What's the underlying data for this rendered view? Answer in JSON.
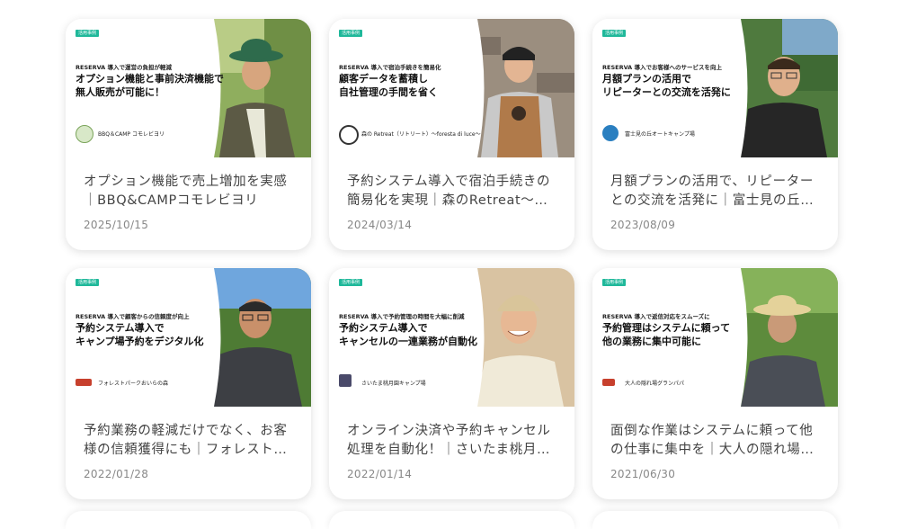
{
  "tag_label": "活用事例",
  "cards": [
    {
      "thumb_subtitle": "RESERVA 導入で運営の負担が軽減",
      "thumb_headline": "オプション機能と事前決済機能で\n無人販売が可能に！",
      "thumb_logo_text": "BBQ＆CAMP コモレビヨリ",
      "title": "オプション機能で売上増加を実感｜BBQ&CAMPコモレビヨリ",
      "date": "2025/10/15"
    },
    {
      "thumb_subtitle": "RESERVA 導入で宿泊手続きを簡易化",
      "thumb_headline": "顧客データを蓄積し\n自社管理の手間を省く",
      "thumb_logo_text": "森の Retreat（リトリート）〜foresta di luce〜",
      "title": "予約システム導入で宿泊手続きの簡易化を実現｜森のRetreat〜…",
      "date": "2024/03/14"
    },
    {
      "thumb_subtitle": "RESERVA 導入でお客様へのサービスを向上",
      "thumb_headline": "月額プランの活用で\nリピーターとの交流を活発に",
      "thumb_logo_text": "富士見の丘オートキャンプ場",
      "title": "月額プランの活用で、リピーターとの交流を活発に｜富士見の丘…",
      "date": "2023/08/09"
    },
    {
      "thumb_subtitle": "RESERVA 導入で顧客からの信頼度が向上",
      "thumb_headline": "予約システム導入で\nキャンプ場予約をデジタル化",
      "thumb_logo_text": "フォレストパークおいらの森",
      "title": "予約業務の軽減だけでなく、お客様の信頼獲得にも｜フォレスト…",
      "date": "2022/01/28"
    },
    {
      "thumb_subtitle": "RESERVA 導入で予約管理の時間を大幅に削減",
      "thumb_headline": "予約システム導入で\nキャンセルの一連業務が自動化",
      "thumb_logo_text": "さいたま桃月園キャンプ場",
      "title": "オンライン決済や予約キャンセル処理を自動化！｜さいたま桃月…",
      "date": "2022/01/14"
    },
    {
      "thumb_subtitle": "RESERVA 導入で返信対応をスムーズに",
      "thumb_headline": "予約管理はシステムに頼って\n他の業務に集中可能に",
      "thumb_logo_text": "大人の隠れ場グランパパ",
      "title": "面倒な作業はシステムに頼って他の仕事に集中を｜大人の隠れ場…",
      "date": "2021/06/30"
    }
  ],
  "colors": {
    "tag": "#1fb89a",
    "title": "#444444",
    "date": "#888888"
  },
  "icons": [
    "person-photo",
    "venue-logo"
  ]
}
